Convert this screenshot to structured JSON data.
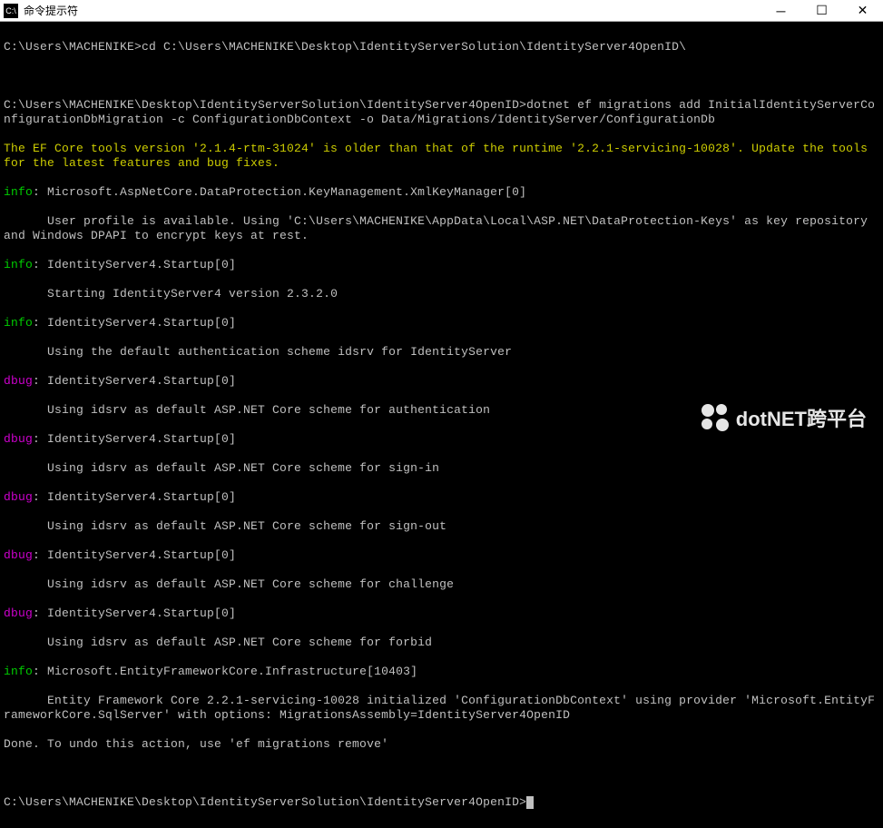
{
  "titlebar": {
    "icon_text": "C:\\",
    "title": "命令提示符"
  },
  "lines": {
    "l1_prompt": "C:\\Users\\MACHENIKE>",
    "l1_cmd": "cd C:\\Users\\MACHENIKE\\Desktop\\IdentityServerSolution\\IdentityServer4OpenID\\",
    "l2_prompt": "C:\\Users\\MACHENIKE\\Desktop\\IdentityServerSolution\\IdentityServer4OpenID>",
    "l2_cmd": "dotnet ef migrations add InitialIdentityServerConfigurationDbMigration -c ConfigurationDbContext -o Data/Migrations/IdentityServer/ConfigurationDb",
    "l3": "The EF Core tools version '2.1.4-rtm-31024' is older than that of the runtime '2.2.1-servicing-10028'. Update the tools for the latest features and bug fixes.",
    "l4_tag": "info",
    "l4_txt": ": Microsoft.AspNetCore.DataProtection.KeyManagement.XmlKeyManager[0]",
    "l5": "      User profile is available. Using 'C:\\Users\\MACHENIKE\\AppData\\Local\\ASP.NET\\DataProtection-Keys' as key repository and Windows DPAPI to encrypt keys at rest.",
    "l6_tag": "info",
    "l6_txt": ": IdentityServer4.Startup[0]",
    "l7": "      Starting IdentityServer4 version 2.3.2.0",
    "l8_tag": "info",
    "l8_txt": ": IdentityServer4.Startup[0]",
    "l9": "      Using the default authentication scheme idsrv for IdentityServer",
    "l10_tag": "dbug",
    "l10_txt": ": IdentityServer4.Startup[0]",
    "l11": "      Using idsrv as default ASP.NET Core scheme for authentication",
    "l12_tag": "dbug",
    "l12_txt": ": IdentityServer4.Startup[0]",
    "l13": "      Using idsrv as default ASP.NET Core scheme for sign-in",
    "l14_tag": "dbug",
    "l14_txt": ": IdentityServer4.Startup[0]",
    "l15": "      Using idsrv as default ASP.NET Core scheme for sign-out",
    "l16_tag": "dbug",
    "l16_txt": ": IdentityServer4.Startup[0]",
    "l17": "      Using idsrv as default ASP.NET Core scheme for challenge",
    "l18_tag": "dbug",
    "l18_txt": ": IdentityServer4.Startup[0]",
    "l19": "      Using idsrv as default ASP.NET Core scheme for forbid",
    "l20_tag": "info",
    "l20_txt": ": Microsoft.EntityFrameworkCore.Infrastructure[10403]",
    "l21": "      Entity Framework Core 2.2.1-servicing-10028 initialized 'ConfigurationDbContext' using provider 'Microsoft.EntityFrameworkCore.SqlServer' with options: MigrationsAssembly=IdentityServer4OpenID",
    "l22": "Done. To undo this action, use 'ef migrations remove'",
    "l23_prompt": "C:\\Users\\MACHENIKE\\Desktop\\IdentityServerSolution\\IdentityServer4OpenID>"
  },
  "watermark": {
    "text": "dotNET跨平台"
  }
}
